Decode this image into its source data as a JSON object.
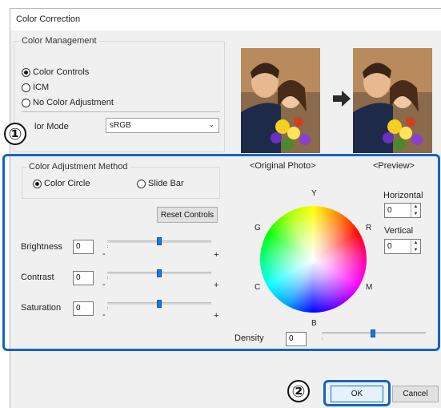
{
  "window": {
    "title": "Color Correction"
  },
  "color_management": {
    "label": "Color Management",
    "options": [
      "Color Controls",
      "ICM",
      "No Color Adjustment"
    ],
    "selected": "Color Controls",
    "mode_label": "Color Mode",
    "mode_label_visible": "lor Mode",
    "mode_value": "sRGB"
  },
  "callouts": {
    "one": "①",
    "two": "②"
  },
  "adjustment": {
    "method_label": "Color Adjustment Method",
    "options": [
      "Color Circle",
      "Slide Bar"
    ],
    "selected": "Color Circle",
    "reset_label": "Reset Controls",
    "sliders": [
      {
        "label": "Brightness",
        "value": "0",
        "min_symbol": "-",
        "max_symbol": "+"
      },
      {
        "label": "Contrast",
        "value": "0",
        "min_symbol": "-",
        "max_symbol": "+"
      },
      {
        "label": "Saturation",
        "value": "0",
        "min_symbol": "-",
        "max_symbol": "+"
      }
    ]
  },
  "preview": {
    "original_label": "<Original Photo>",
    "preview_label": "<Preview>",
    "horizontal_label": "Horizontal",
    "horizontal_value": "0",
    "vertical_label": "Vertical",
    "vertical_value": "0",
    "wheel_labels": {
      "Y": "Y",
      "R": "R",
      "M": "M",
      "B": "B",
      "C": "C",
      "G": "G"
    },
    "density_label": "Density",
    "density_value": "0"
  },
  "footer": {
    "ok_label": "OK",
    "cancel_label": "Cancel"
  },
  "colors": {
    "highlight": "#1565c0",
    "slider_thumb": "#1f7ad6"
  }
}
